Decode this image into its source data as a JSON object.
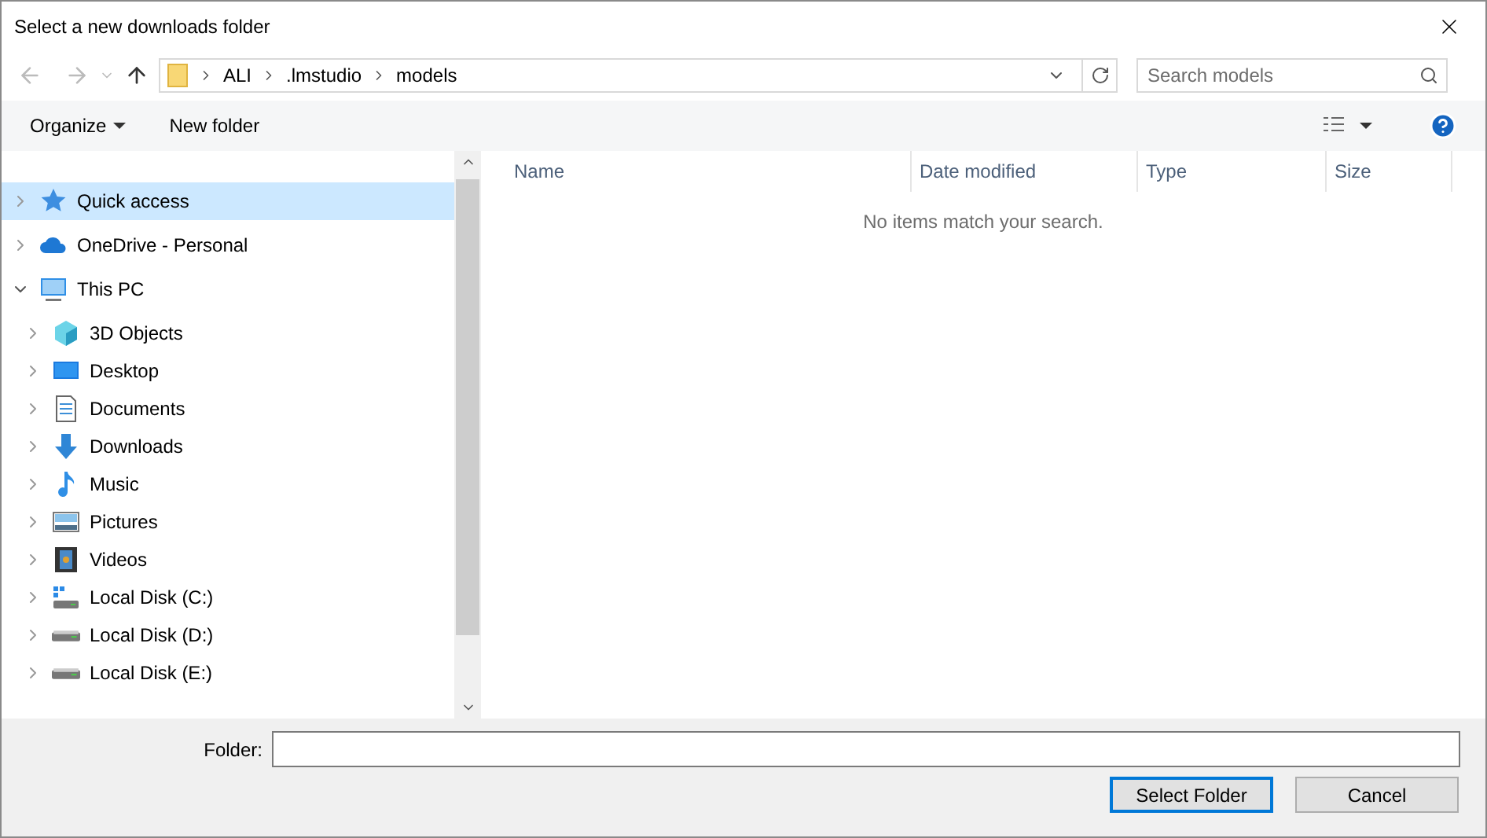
{
  "window": {
    "title": "Select a new downloads folder"
  },
  "address": {
    "path": [
      {
        "label": "ALI"
      },
      {
        "label": ".lmstudio"
      },
      {
        "label": "models"
      }
    ]
  },
  "search": {
    "placeholder": "Search models"
  },
  "toolbar": {
    "organize": "Organize",
    "new_folder": "New folder"
  },
  "tree": [
    {
      "label": "Quick access",
      "kind": "star",
      "expanded": false,
      "selected": true
    },
    {
      "label": "OneDrive - Personal",
      "kind": "cloud",
      "expanded": false,
      "selected": false
    },
    {
      "label": "This PC",
      "kind": "pc",
      "expanded": true,
      "selected": false,
      "children": [
        {
          "label": "3D Objects",
          "kind": "cube",
          "expanded": false,
          "selected": false
        },
        {
          "label": "Desktop",
          "kind": "desktop",
          "expanded": false,
          "selected": false
        },
        {
          "label": "Documents",
          "kind": "doc",
          "expanded": false,
          "selected": false
        },
        {
          "label": "Downloads",
          "kind": "download",
          "expanded": false,
          "selected": false
        },
        {
          "label": "Music",
          "kind": "music",
          "expanded": false,
          "selected": false
        },
        {
          "label": "Pictures",
          "kind": "pictures",
          "expanded": false,
          "selected": false
        },
        {
          "label": "Videos",
          "kind": "video",
          "expanded": false,
          "selected": false
        },
        {
          "label": "Local Disk (C:)",
          "kind": "sysdisk",
          "expanded": false,
          "selected": false
        },
        {
          "label": "Local Disk (D:)",
          "kind": "disk",
          "expanded": false,
          "selected": false
        },
        {
          "label": "Local Disk (E:)",
          "kind": "disk",
          "expanded": false,
          "selected": false
        }
      ]
    }
  ],
  "columns": [
    {
      "label": "Name"
    },
    {
      "label": "Date modified"
    },
    {
      "label": "Type"
    },
    {
      "label": "Size"
    }
  ],
  "empty_message": "No items match your search.",
  "folder_field": {
    "label": "Folder:"
  },
  "buttons": [
    {
      "label": "Select Folder",
      "default": true
    },
    {
      "label": "Cancel",
      "default": false
    }
  ]
}
